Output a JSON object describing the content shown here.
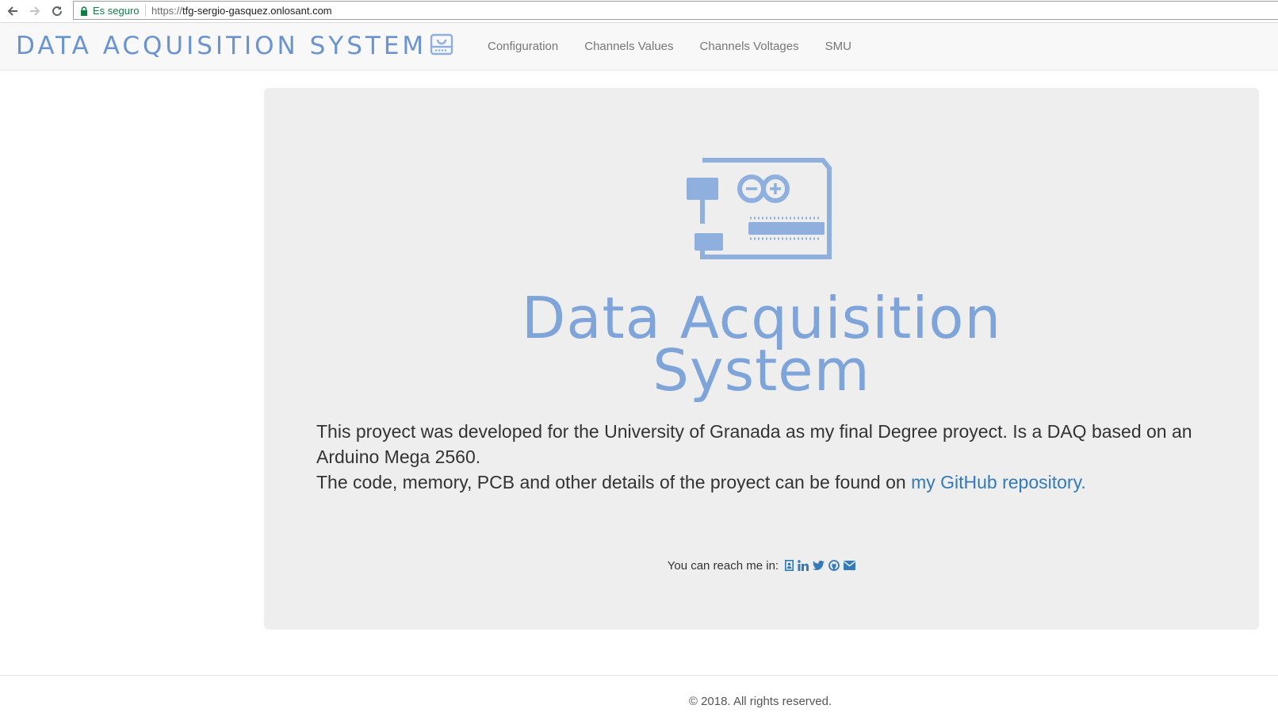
{
  "browser": {
    "secure_label": "Es seguro",
    "url_scheme": "https://",
    "url_host": "tfg-sergio-gasquez.onlosant.com"
  },
  "navbar": {
    "brand": "DATA ACQUISITION SYSTEM",
    "brand_icon": "hard-drive-icon",
    "links": [
      "Configuration",
      "Channels Values",
      "Channels Voltages",
      "SMU"
    ]
  },
  "hero": {
    "logo_icon": "arduino-board-icon",
    "title_line1": "Data Acquisition",
    "title_line2": "System",
    "description_line1": "This proyect was developed for the University of Granada as my final Degree proyect. Is a DAQ based on an Arduino Mega 2560.",
    "description_line2_prefix": "The code, memory, PCB and other details of the proyect can be found on ",
    "repo_link": "my GitHub repository.",
    "reach_label": "You can reach me in:",
    "social_icons": [
      "contact-card-icon",
      "linkedin-icon",
      "twitter-icon",
      "github-icon",
      "envelope-icon"
    ]
  },
  "footer": {
    "copyright": "© 2018. All rights reserved."
  },
  "colors": {
    "accent": "#337ab7",
    "brand": "#6a94cf",
    "secure": "#0b8043",
    "jumbotron_bg": "#eeeeee",
    "navbar_bg": "#f8f8f8"
  }
}
